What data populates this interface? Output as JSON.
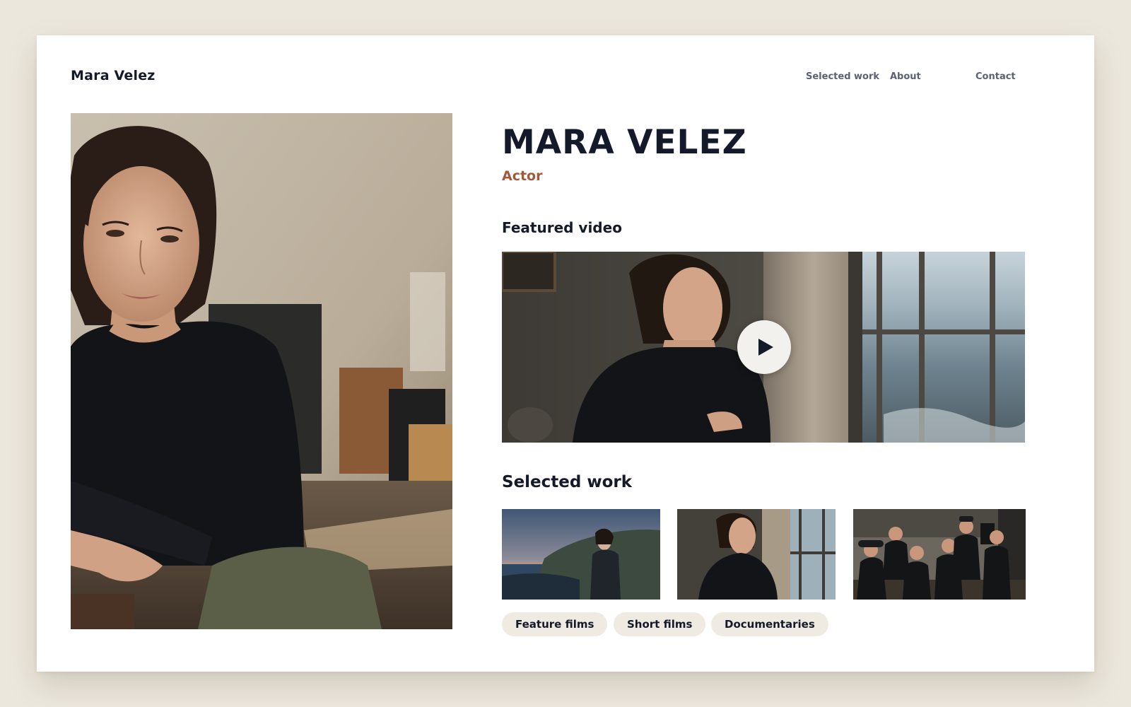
{
  "site": {
    "brand": "Mara Velez"
  },
  "nav": {
    "items": [
      {
        "label": "Selected work"
      },
      {
        "label": "About"
      },
      {
        "label": "Contact"
      }
    ]
  },
  "hero": {
    "name": "MARA VELEZ",
    "role": "Actor",
    "portrait_icon": "portrait-photo"
  },
  "featured": {
    "heading": "Featured video",
    "play_icon": "play-icon"
  },
  "work": {
    "heading": "Selected work",
    "thumbnails": [
      {
        "icon": "coastline-photo"
      },
      {
        "icon": "window-photo"
      },
      {
        "icon": "film-crew-photo"
      }
    ],
    "categories": [
      {
        "label": "Feature films"
      },
      {
        "label": "Short films"
      },
      {
        "label": "Documentaries"
      }
    ]
  },
  "colors": {
    "page_background": "#ece7dd",
    "card_background": "#ffffff",
    "text_primary": "#151a2b",
    "nav_text": "#5d6272",
    "accent_role": "#a0593b",
    "chip_background": "#efebe2"
  }
}
